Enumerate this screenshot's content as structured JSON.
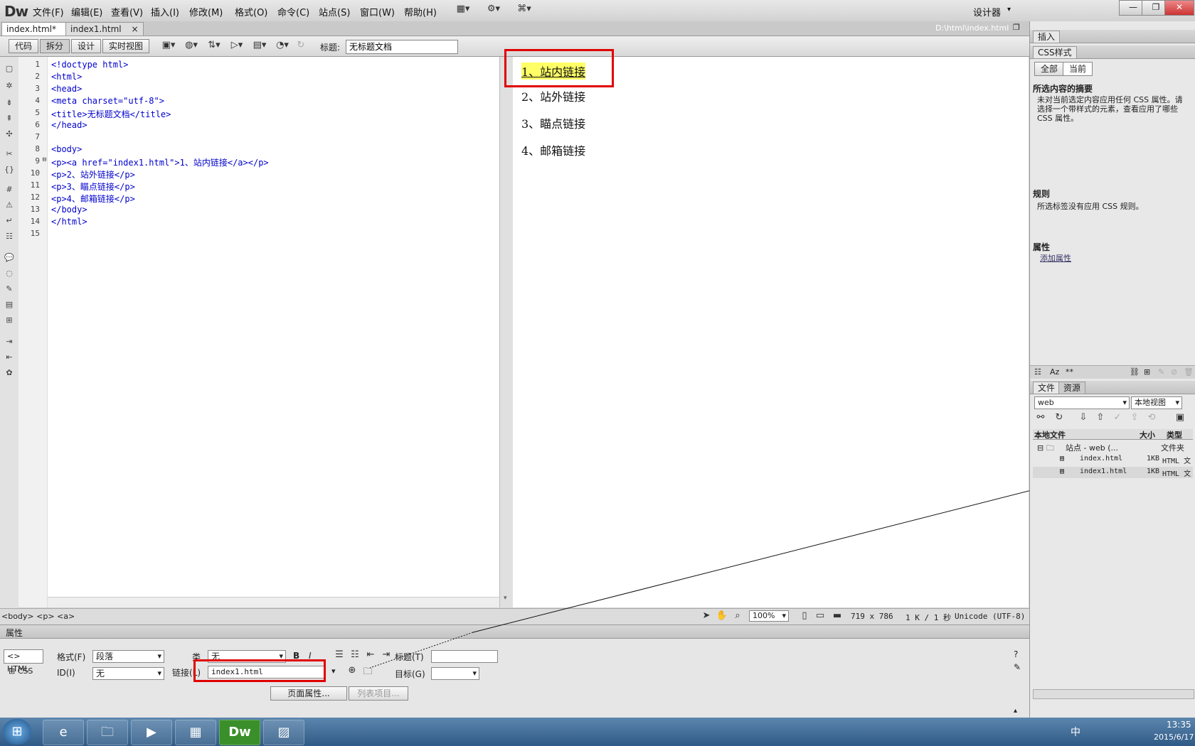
{
  "app": {
    "logo": "Dw",
    "menus": [
      "文件(F)",
      "编辑(E)",
      "查看(V)",
      "插入(I)",
      "修改(M)",
      "格式(O)",
      "命令(C)",
      "站点(S)",
      "窗口(W)",
      "帮助(H)"
    ],
    "workspace": "设计器",
    "window_controls": [
      "—",
      "❐",
      "✕"
    ]
  },
  "tabs": [
    {
      "label": "index.html*",
      "close": "×"
    },
    {
      "label": "index1.html",
      "close": "×"
    }
  ],
  "file_path": "D:\\html\\index.html",
  "doc_toolbar": {
    "views": [
      "代码",
      "拆分",
      "设计",
      "实时视图"
    ],
    "title_label": "标题:",
    "title_value": "无标题文档"
  },
  "code": {
    "line_numbers": [
      "1",
      "2",
      "3",
      "4",
      "5",
      "6",
      "7",
      "8",
      "9",
      "10",
      "11",
      "12",
      "13",
      "14",
      "15"
    ],
    "lines": [
      "<!doctype html>",
      "<html>",
      "<head>",
      "<meta charset=\"utf-8\">",
      "<title>无标题文档</title>",
      "</head>",
      "",
      "<body>",
      "<p><a href=\"index1.html\">1、站内链接</a></p>",
      "<p>2、站外链接</p>",
      "<p>3、瞄点链接</p>",
      "<p>4、邮箱链接</p>",
      "</body>",
      "</html>",
      ""
    ]
  },
  "design": {
    "paragraphs": [
      "1、站内链接",
      "2、站外链接",
      "3、瞄点链接",
      "4、邮箱链接"
    ]
  },
  "status": {
    "tag_path": "<body> <p> <a>",
    "zoom": "100%",
    "size": "719 x 786",
    "file_info": "1 K / 1 秒",
    "encoding": "Unicode (UTF-8)"
  },
  "properties": {
    "header": "属性",
    "html_btn": "HTML",
    "css_btn": "CSS",
    "format_label": "格式(F)",
    "format_value": "段落",
    "class_label": "类",
    "class_value": "无",
    "id_label": "ID(I)",
    "id_value": "无",
    "link_label": "链接(L)",
    "link_value": "index1.html",
    "title_label": "标题(T)",
    "target_label": "目标(G)",
    "bold": "B",
    "italic": "I",
    "page_props": "页面属性...",
    "list_item": "列表项目..."
  },
  "right_panel": {
    "insert_tab": "插入",
    "css_tab": "CSS样式",
    "all_btn": "全部",
    "current_btn": "当前",
    "summary_title": "所选内容的摘要",
    "summary_text": "未对当前选定内容应用任何 CSS 属性。请选择一个带样式的元素，查看应用了哪些 CSS 属性。",
    "rules_title": "规则",
    "rules_text": "所选标签没有应用 CSS 规则。",
    "props_title": "属性",
    "add_prop": "添加属性",
    "files_tab": "文件",
    "assets_tab": "资源",
    "site_select": "web",
    "view_select": "本地视图",
    "col_local": "本地文件",
    "col_size": "大小",
    "col_type": "类型",
    "tree": [
      {
        "name": "站点 - web (...",
        "size": "",
        "type": "文件夹"
      },
      {
        "name": "index.html",
        "size": "1KB",
        "type": "HTML 文"
      },
      {
        "name": "index1.html",
        "size": "1KB",
        "type": "HTML 文"
      }
    ]
  },
  "taskbar": {
    "time": "13:35",
    "date": "2015/6/17",
    "ime": "中"
  },
  "colors": {
    "highlight_box": "#e00000",
    "link_highlight": "#ffff66"
  }
}
